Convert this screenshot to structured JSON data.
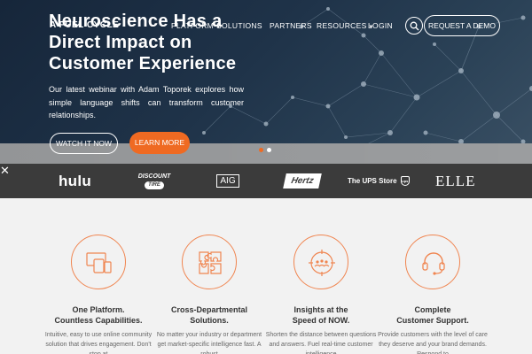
{
  "nav": {
    "brand": "A FUEL CYCLE",
    "items": [
      {
        "label": "PLATFORM",
        "caret": "▼"
      },
      {
        "label": "SOLUTIONS",
        "caret": ""
      },
      {
        "label": "PARTNERS",
        "caret": ""
      },
      {
        "label": "RESOURCES",
        "caret": "▼"
      },
      {
        "label": "LOGIN",
        "caret": ""
      }
    ],
    "search_icon": "search-icon",
    "demo_label": "REQUEST A DEMO"
  },
  "hero": {
    "headline": [
      "Neuroscience Has a",
      "Direct Impact on",
      "Customer Experience"
    ],
    "subtext": "Our latest webinar with Adam Toporek explores how simple language shifts can transform customer relationships.",
    "watch_label": "WATCH IT NOW",
    "learn_label": "LEARN MORE",
    "slide_count": 2,
    "active_slide": 1
  },
  "logos": {
    "close_icon": "close-icon",
    "hulu": "hulu",
    "discount_tire_top": "DISCOUNT",
    "discount_tire_bottom": "TIRE",
    "aig": "AIG",
    "hertz": "Hertz",
    "ups": "The UPS Store",
    "ups_badge": "ups",
    "elle": "ELLE"
  },
  "features": [
    {
      "icon": "devices-icon",
      "title": [
        "One Platform.",
        "Countless Capabilities."
      ],
      "text": "Intuitive, easy to use online community solution that drives engagement. Don't stop at"
    },
    {
      "icon": "puzzle-icon",
      "title": [
        "Cross-Departmental",
        "Solutions."
      ],
      "text": "No matter your industry or department get market-specific intelligence fast. A robust"
    },
    {
      "icon": "crowd-focus-icon",
      "title": [
        "Insights at the",
        "Speed of NOW."
      ],
      "text": "Shorten the distance between questions and answers. Fuel real-time customer intelligence"
    },
    {
      "icon": "headset-icon",
      "title": [
        "Complete",
        "Customer Support."
      ],
      "text": "Provide customers with the level of care they deserve and your brand demands. Respond to"
    }
  ],
  "colors": {
    "accent": "#ef6a22",
    "hero_dark": "#1f3349",
    "logo_strip": "#3b3b3b",
    "feature_bg": "#f2f2f2",
    "dot_active": "#ef6a22",
    "dot_inactive": "#ffffff"
  }
}
